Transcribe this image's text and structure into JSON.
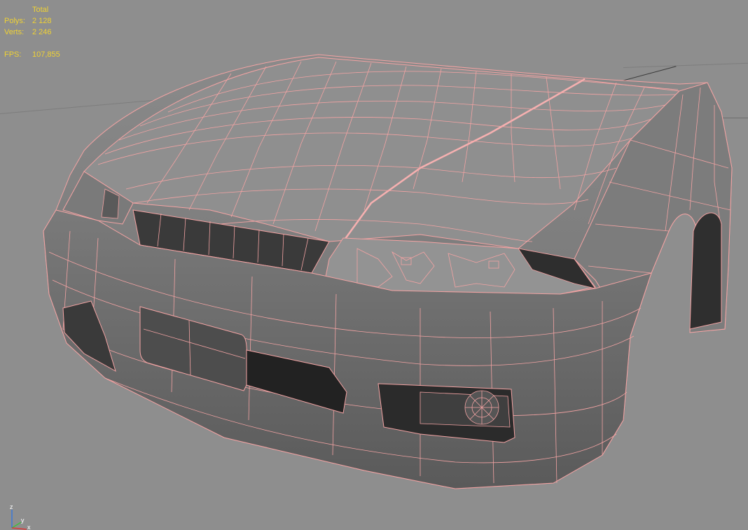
{
  "stats": {
    "header": "Total",
    "polys_label": "Polys:",
    "polys_value": "2 128",
    "verts_label": "Verts:",
    "verts_value": "2 246",
    "fps_label": "FPS:",
    "fps_value": "107,855"
  },
  "axis": {
    "z_label": "z",
    "y_label": "y",
    "x_label": "x"
  },
  "colors": {
    "background": "#8e8e8e",
    "wire": "#f3a3a3",
    "stats_text": "#f0d234",
    "axis_z": "#3a78d8",
    "axis_y": "#3fbf3f",
    "axis_x": "#d83a3a"
  }
}
